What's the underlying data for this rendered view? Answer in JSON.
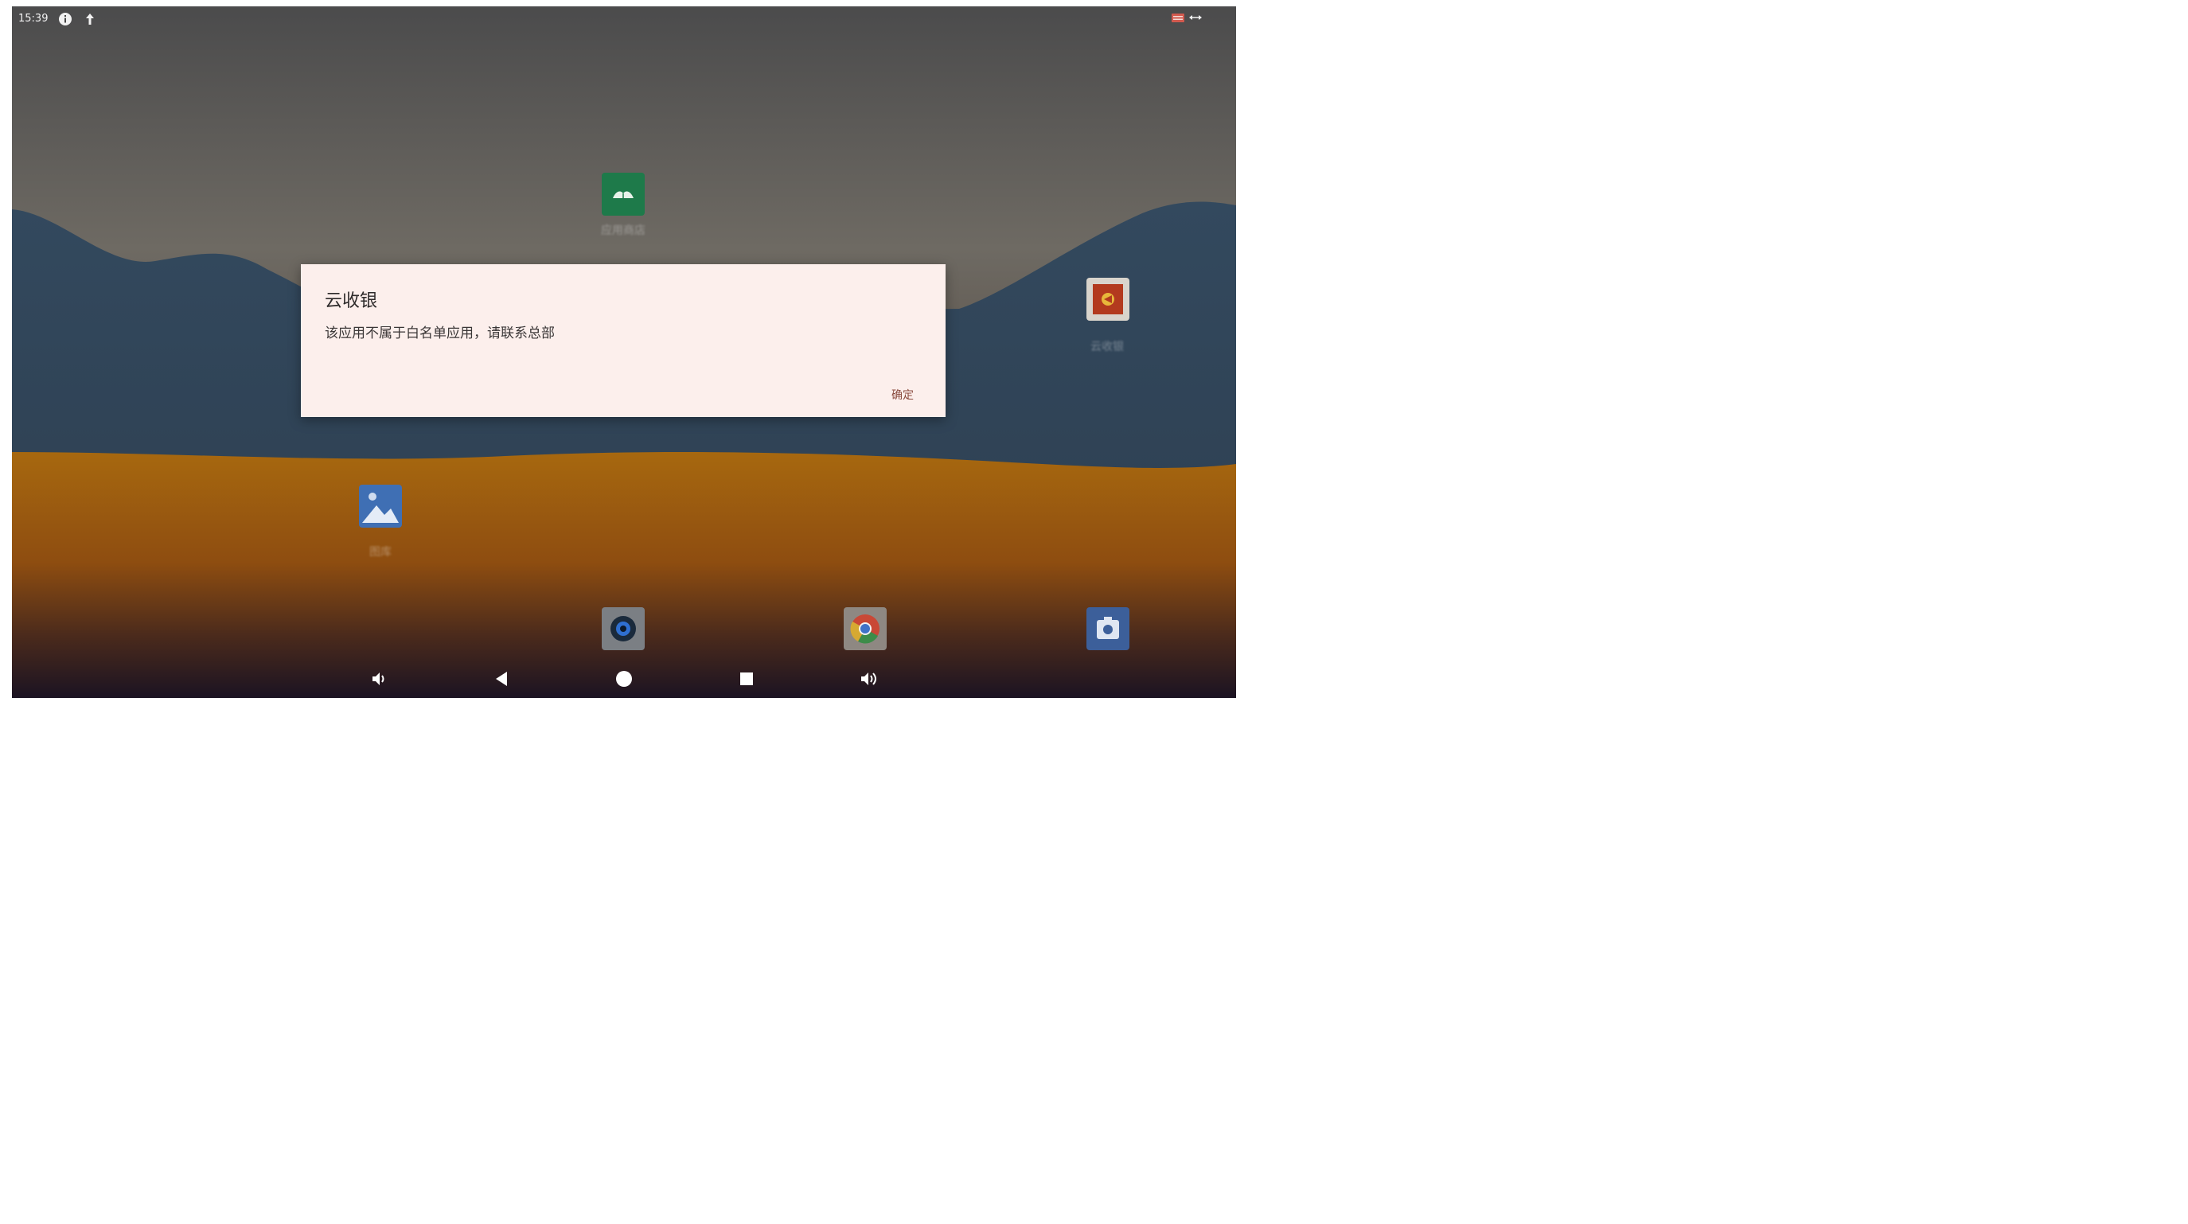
{
  "status_bar": {
    "time": "15:39",
    "icons": [
      "info-icon",
      "upload-icon",
      "keyboard-icon",
      "usb-icon"
    ]
  },
  "desktop_apps": [
    {
      "name": "green-book-app",
      "label": "应用商店",
      "icon": "book-icon",
      "color": "#1e7a4a"
    },
    {
      "name": "red-app",
      "label": "云收银",
      "icon": "red-app-icon",
      "color": "#b33a1e"
    },
    {
      "name": "gallery-app",
      "label": "图库",
      "icon": "image-icon",
      "color": "#3f6fb4"
    }
  ],
  "dock_apps": [
    {
      "name": "camera-dock",
      "icon": "camera-lens-icon"
    },
    {
      "name": "chrome-dock",
      "icon": "chrome-icon"
    },
    {
      "name": "settings-dock",
      "icon": "settings-icon"
    }
  ],
  "dialog": {
    "title": "云收银",
    "message": "该应用不属于白名单应用，请联系总部",
    "confirm_label": "确定"
  },
  "navigation": [
    "volume-down-icon",
    "back-icon",
    "home-icon",
    "recents-icon",
    "volume-up-icon"
  ]
}
